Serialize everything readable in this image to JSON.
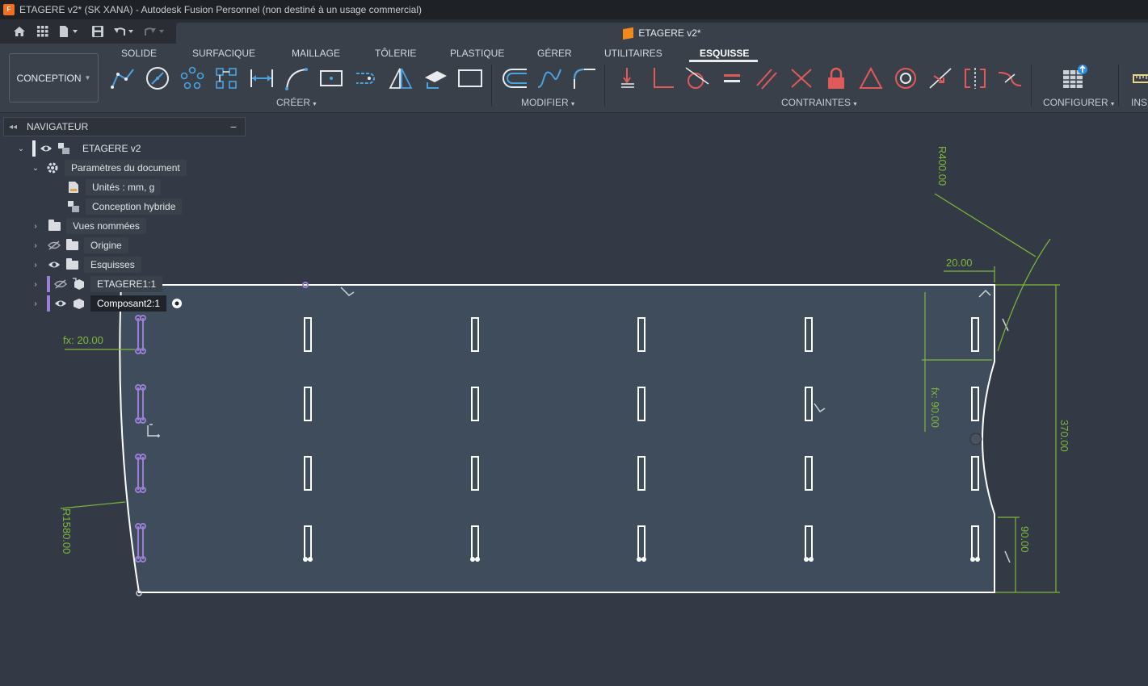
{
  "window": {
    "title": "ETAGERE v2* (SK XANA) - Autodesk Fusion Personnel (non destiné à un usage commercial)",
    "app_icon_text": "F"
  },
  "document_tab": {
    "title": "ETAGERE v2*"
  },
  "workspace": {
    "label": "CONCEPTION"
  },
  "ribbon": {
    "tabs": [
      {
        "label": "SOLIDE"
      },
      {
        "label": "SURFACIQUE"
      },
      {
        "label": "MAILLAGE"
      },
      {
        "label": "TÔLERIE"
      },
      {
        "label": "PLASTIQUE"
      },
      {
        "label": "GÉRER"
      },
      {
        "label": "UTILITAIRES"
      },
      {
        "label": "ESQUISSE",
        "active": true
      }
    ],
    "groups": {
      "creer": "CRÉER",
      "modifier": "MODIFIER",
      "contraintes": "CONTRAINTES",
      "configurer": "CONFIGURER",
      "inspecter": "INS"
    }
  },
  "navigator": {
    "title": "NAVIGATEUR",
    "nodes": {
      "root": "ETAGERE v2",
      "params": "Paramètres du document",
      "units": "Unités : mm, g",
      "hybrid": "Conception hybride",
      "named_views": "Vues nommées",
      "origin": "Origine",
      "sketches": "Esquisses",
      "etagere1": "ETAGERE1:1",
      "composant2": "Composant2:1"
    }
  },
  "sketch": {
    "dimensions": {
      "r400": "R400.00",
      "d20_top": "20.00",
      "fx20": "fx: 20.00",
      "fx90": "fx: 90.00",
      "d370": "370.00",
      "d90": "90.00",
      "r1580": "R1580.00"
    }
  },
  "colors": {
    "sketch_line": "#ffffff",
    "dimension": "#7fb83a",
    "profile_fill": "#3e4c5c",
    "constraint": "#e05a5a",
    "selected": "#9b7fd4"
  }
}
